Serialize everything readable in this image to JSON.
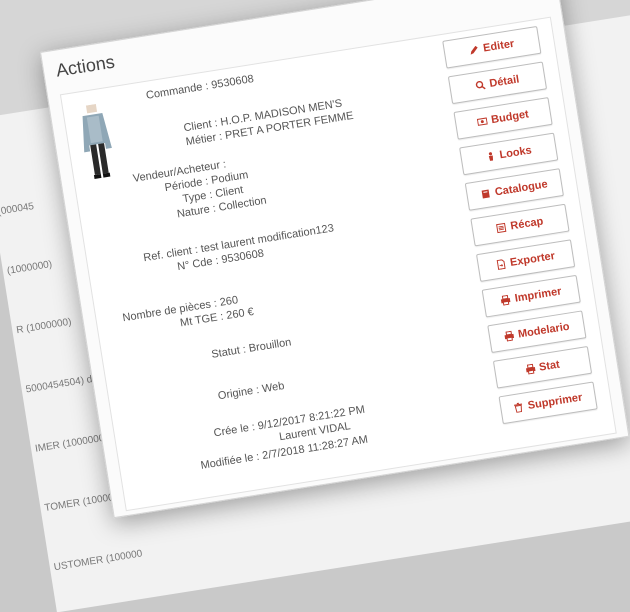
{
  "panel": {
    "title": "Actions"
  },
  "order": {
    "commande": "Commande : 9530608",
    "client": "Client : H.O.P. MADISON MEN'S",
    "metier": "Métier : PRET A PORTER FEMME",
    "vendeur": "Vendeur/Acheteur :",
    "periode": "Période : Podium",
    "type": "Type : Client",
    "nature": "Nature : Collection",
    "ref_client": "Ref. client : test laurent modification123",
    "no_cde": "N° Cde : 9530608",
    "nb_pieces": "Nombre de pièces : 260",
    "mt_tge": "Mt TGE : 260 €",
    "statut": "Statut : Brouillon",
    "origine": "Origine : Web",
    "cree_le": "Crée le : 9/12/2017 8:21:22 PM",
    "cree_par": "Laurent VIDAL",
    "modifiee_le": "Modifiée le : 2/7/2018 11:28:27 AM"
  },
  "actions": {
    "editer": "Editer",
    "detail": "Détail",
    "budget": "Budget",
    "looks": "Looks",
    "catalogue": "Catalogue",
    "recap": "Récap",
    "exporter": "Exporter",
    "imprimer": "Imprimer",
    "modelario": "Modelario",
    "stat": "Stat",
    "supprimer": "Supprimer"
  },
  "background_rows": [
    "(000045",
    "(1000000)",
    "R (1000000)",
    "5000454504) d",
    "IMER (1000000)",
    "TOMER (1000000)",
    "USTOMER (100000"
  ],
  "colors": {
    "accent": "#c0392b"
  }
}
